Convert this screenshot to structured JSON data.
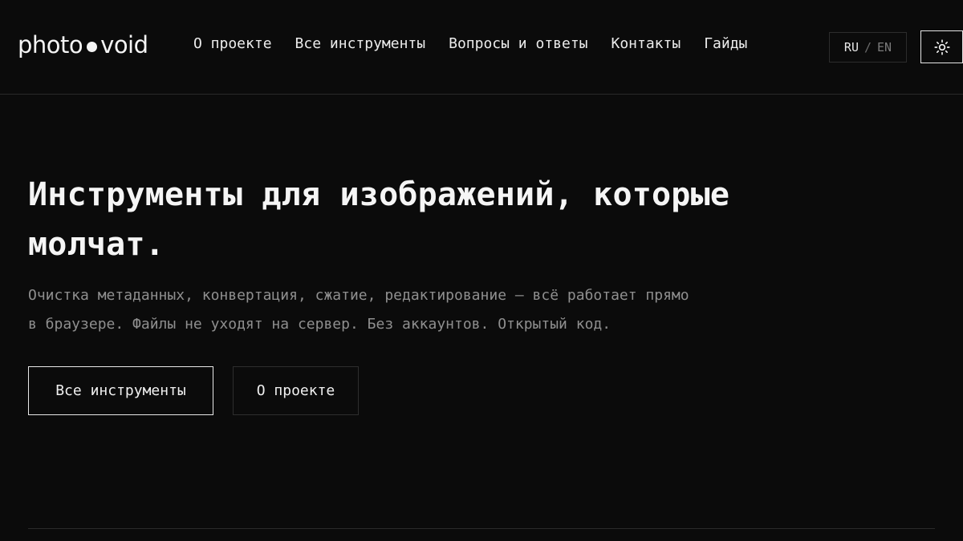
{
  "header": {
    "logo": {
      "left": "photo",
      "right": "void"
    },
    "nav": {
      "items": [
        {
          "label": "О проекте"
        },
        {
          "label": "Все инструменты"
        },
        {
          "label": "Вопросы и ответы"
        },
        {
          "label": "Контакты"
        },
        {
          "label": "Гайды"
        }
      ]
    },
    "lang": {
      "active": "RU",
      "separator": "/",
      "inactive": "EN"
    },
    "theme_toggle_icon": "sun-icon"
  },
  "hero": {
    "title_line1": "Инструменты для изображений, которые",
    "title_line2": "молчат.",
    "subtitle_line1": "Очистка метаданных, конвертация, сжатие, редактирование — всё работает прямо",
    "subtitle_line2": "в браузере. Файлы не уходят на сервер. Без аккаунтов. Открытый код.",
    "primary_button": "Все инструменты",
    "secondary_button": "О проекте"
  },
  "colors": {
    "background": "#0b0b0b",
    "text": "#f2f2f2",
    "muted": "#8f8f8f",
    "border": "#2a2a2a"
  }
}
